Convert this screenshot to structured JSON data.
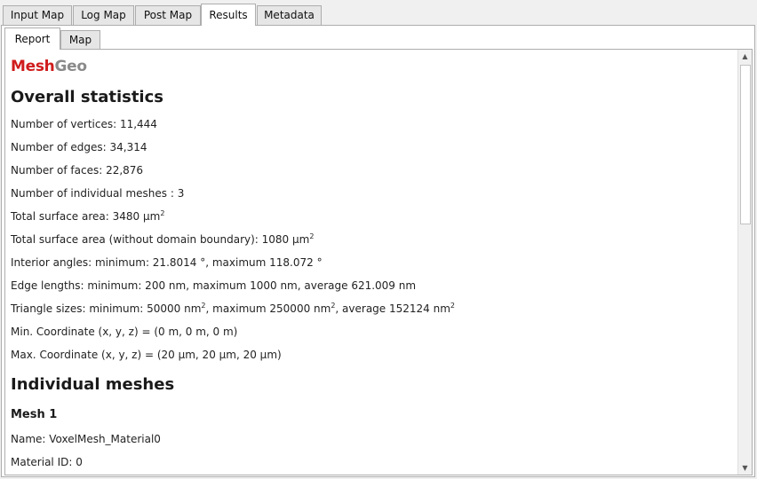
{
  "tabs": [
    "Input Map",
    "Log Map",
    "Post Map",
    "Results",
    "Metadata"
  ],
  "subtabs": [
    "Report",
    "Map"
  ],
  "brand": {
    "part1": "Mesh",
    "part2": "Geo"
  },
  "overall": {
    "heading": "Overall statistics",
    "vertices": "Number of vertices: 11,444",
    "edges": "Number of edges: 34,314",
    "faces": "Number of faces: 22,876",
    "meshes": "Number of individual meshes : 3",
    "area_prefix": "Total surface area: 3480 µm",
    "area_sup": "2",
    "area2_prefix": "Total surface area (without domain boundary): 1080 µm",
    "area2_sup": "2",
    "angles": "Interior angles: minimum: 21.8014 °, maximum 118.072 °",
    "edge_lengths": "Edge lengths: minimum: 200 nm, maximum 1000 nm, average 621.009 nm",
    "tri_part1": "Triangle sizes: minimum: 50000 nm",
    "tri_part2": ", maximum 250000 nm",
    "tri_part3": ", average 152124 nm",
    "tri_sup": "2",
    "min_coord": "Min. Coordinate (x, y, z) = (0 m, 0 m, 0 m)",
    "max_coord": "Max. Coordinate (x, y, z) = (20 µm, 20 µm, 20 µm)"
  },
  "individual": {
    "heading": "Individual meshes",
    "mesh1_title": "Mesh 1",
    "mesh1_name": "Name: VoxelMesh_Material0",
    "mesh1_material": "Material ID: 0"
  },
  "icons": {
    "scroll_up": "up-arrow-icon",
    "scroll_down": "down-arrow-icon"
  }
}
